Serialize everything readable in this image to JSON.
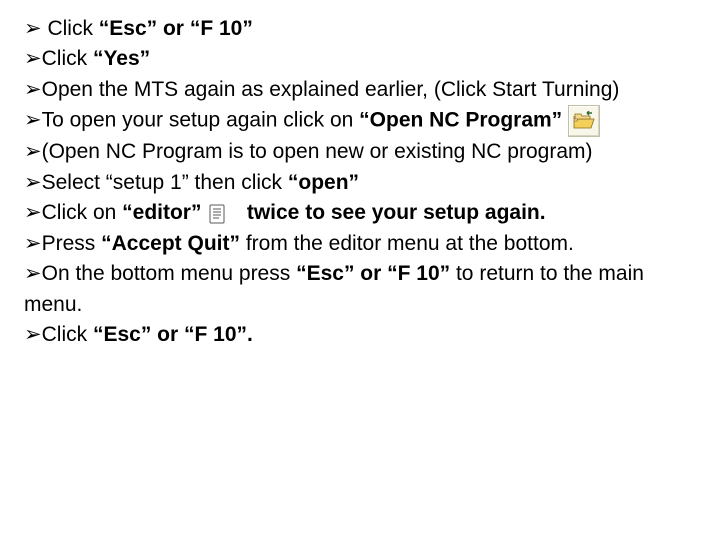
{
  "bullet_char": "➢",
  "lines": {
    "l1": {
      "pre": " Click ",
      "b": "“Esc” or “F 10”"
    },
    "l2": {
      "pre": "Click ",
      "b": "“Yes”"
    },
    "l3": {
      "text": "Open the MTS again as explained earlier, (Click Start Turning)"
    },
    "l4": {
      "pre": "To open your setup again click on ",
      "b": "“Open NC Program”"
    },
    "l5": {
      "text": "(Open NC Program is to open new or existing NC program)"
    },
    "l6": {
      "pre": "Select “setup 1” then click ",
      "b": "“open”"
    },
    "l7": {
      "pre": "Click on ",
      "b1": "“editor”",
      "mid": " ",
      "b2": "twice to see your setup again."
    },
    "l8": {
      "pre": "Press ",
      "b1": "“Accept Quit”",
      "post": " from the editor menu at the bottom."
    },
    "l9": {
      "pre": "On the bottom menu press ",
      "b1": "“Esc” or “F 10”",
      "post": " to return to the main menu."
    },
    "l10": {
      "pre": "Click ",
      "b": "“Esc” or “F 10”."
    }
  }
}
